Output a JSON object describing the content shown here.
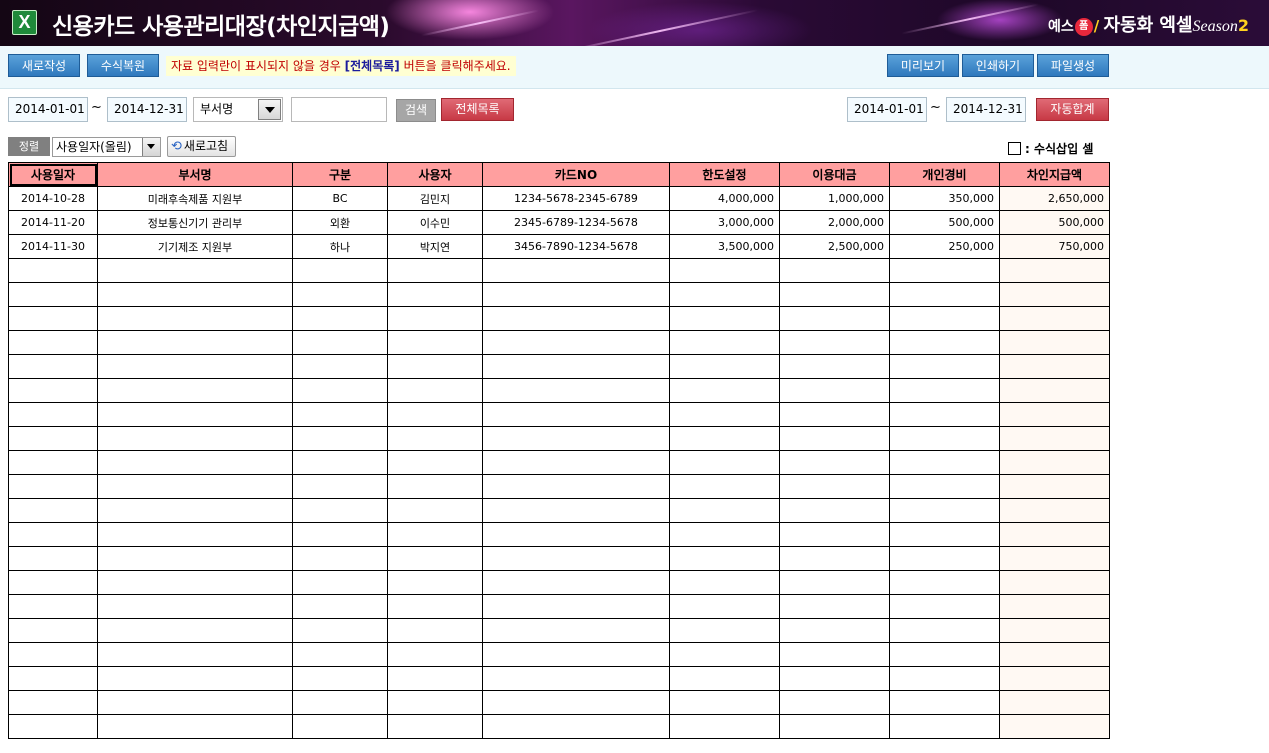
{
  "app": {
    "title": "신용카드 사용관리대장(차인지급액)"
  },
  "brand": {
    "prefix": "예스",
    "badge": "폼",
    "name": "자동화 엑셀",
    "season": "Season",
    "season_num": "2"
  },
  "toolbar": {
    "new": "새로작성",
    "restore": "수식복원",
    "notice_part1": "자료 입력란이 표시되지  않을 경우 ",
    "notice_link": "[전체목록]",
    "notice_part2": " 버튼을 클릭해주세요.",
    "preview": "미리보기",
    "print": "인쇄하기",
    "file": "파일생성"
  },
  "filter": {
    "from": "2014-01-01",
    "tilde": "~",
    "to": "2014-12-31",
    "dept": "부서명",
    "keyword": "",
    "search": "검색",
    "all_list": "전체목록",
    "sum_from": "2014-01-01",
    "sum_to": "2014-12-31",
    "auto_sum": "자동합계"
  },
  "sort": {
    "label": "정렬",
    "value": "사용일자(올림)",
    "refresh": "새로고침",
    "formula_label": ": 수식삽입 셀"
  },
  "table": {
    "headers": [
      "사용일자",
      "부서명",
      "구분",
      "사용자",
      "카드NO",
      "한도설정",
      "이용대금",
      "개인경비",
      "차인지급액"
    ],
    "rows": [
      [
        "2014-10-28",
        "미래후속제품 지원부",
        "BC",
        "김민지",
        "1234-5678-2345-6789",
        "4,000,000",
        "1,000,000",
        "350,000",
        "2,650,000"
      ],
      [
        "2014-11-20",
        "정보통신기기 관리부",
        "외환",
        "이수민",
        "2345-6789-1234-5678",
        "3,000,000",
        "2,000,000",
        "500,000",
        "500,000"
      ],
      [
        "2014-11-30",
        "기기제조 지원부",
        "하나",
        "박지연",
        "3456-7890-1234-5678",
        "3,500,000",
        "2,500,000",
        "250,000",
        "750,000"
      ]
    ],
    "empty_rows": 20
  }
}
